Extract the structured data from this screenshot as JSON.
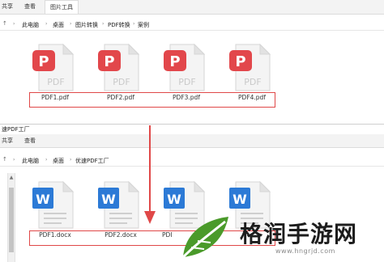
{
  "top_window": {
    "ribbon": {
      "tabs": [
        "共享",
        "查看"
      ],
      "active_tab": "图片工具"
    },
    "breadcrumb": [
      "此电脑",
      "桌面",
      "图片转换",
      "PDF转换",
      "案例"
    ],
    "files": [
      {
        "label": "PDF1.pdf",
        "type": "pdf",
        "icon": "pdf-file-icon",
        "badge": "PDF"
      },
      {
        "label": "PDF2.pdf",
        "type": "pdf",
        "icon": "pdf-file-icon",
        "badge": "PDF"
      },
      {
        "label": "PDF3.pdf",
        "type": "pdf",
        "icon": "pdf-file-icon",
        "badge": "PDF"
      },
      {
        "label": "PDF4.pdf",
        "type": "pdf",
        "icon": "pdf-file-icon",
        "badge": "PDF"
      }
    ]
  },
  "bottom_window": {
    "title": "速PDF工厂",
    "ribbon": {
      "tabs": [
        "共享",
        "查看"
      ]
    },
    "breadcrumb": [
      "此电脑",
      "桌面",
      "优速PDF工厂"
    ],
    "files": [
      {
        "label": "PDF1.docx",
        "type": "docx",
        "icon": "word-file-icon",
        "badge": "W"
      },
      {
        "label": "PDF2.docx",
        "type": "docx",
        "icon": "word-file-icon",
        "badge": "W"
      },
      {
        "label": "PDI",
        "type": "docx",
        "icon": "word-file-icon",
        "badge": "W"
      },
      {
        "label": "",
        "type": "docx",
        "icon": "word-file-icon",
        "badge": "W"
      }
    ]
  },
  "colors": {
    "pdf_red": "#e2474b",
    "word_blue": "#2c7ad6",
    "selection_red": "#e04848",
    "watermark_green": "#4a9a2a"
  },
  "watermark": {
    "text": "格润手游网",
    "url": "www.hngrjd.com"
  }
}
